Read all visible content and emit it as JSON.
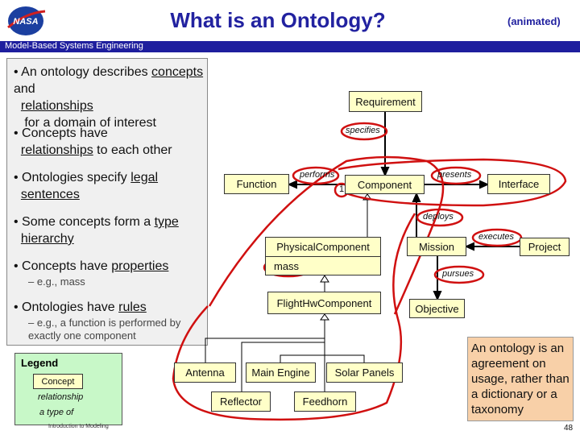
{
  "header": {
    "title": "What is an Ontology?",
    "animated": "(animated)",
    "subtitle": "Model-Based Systems Engineering",
    "logo_text": "NASA"
  },
  "bullets": [
    {
      "pre": "An ontology describes ",
      "u1": "concepts",
      "mid": " and ",
      "u2": "relationships",
      "post": " for a domain of interest"
    },
    {
      "pre": "Concepts have ",
      "u1": "relationships",
      "post": " to each other"
    },
    {
      "pre": "Ontologies specify ",
      "u1": "legal sentences"
    },
    {
      "pre": "Some concepts form a ",
      "u1": "type hierarchy"
    },
    {
      "pre": "Concepts have ",
      "u1": "properties",
      "sub": "– e.g., mass"
    },
    {
      "pre": "Ontologies have ",
      "u1": "rules",
      "sub": "– e.g., a function is performed by exactly one component"
    }
  ],
  "diagram": {
    "classes": {
      "requirement": "Requirement",
      "function": "Function",
      "component": "Component",
      "interface": "Interface",
      "physical": "PhysicalComponent",
      "mass": "mass",
      "mission": "Mission",
      "project": "Project",
      "flighthw": "FlightHwComponent",
      "objective": "Objective",
      "antenna": "Antenna",
      "engine": "Main Engine",
      "solar": "Solar Panels",
      "reflector": "Reflector",
      "feedhorn": "Feedhorn"
    },
    "relations": {
      "specifies": "specifies",
      "performs": "performs",
      "multiplicity": "1",
      "presents": "presents",
      "deploys": "deploys",
      "executes": "executes",
      "pursues": "pursues"
    }
  },
  "legend": {
    "title": "Legend",
    "concept": "Concept",
    "relationship": "relationship",
    "type_of": "a type of",
    "footer": "Introduction to Modeling"
  },
  "note": "An ontology is an agreement on usage, rather than a dictionary or a taxonomy",
  "page_number": "48",
  "colors": {
    "title": "#2222a0",
    "bar": "#1e1e9e",
    "class_fill": "#ffffc8",
    "highlight": "#d01010",
    "legend": "#c8f8c8",
    "note": "#f8d0a8"
  }
}
